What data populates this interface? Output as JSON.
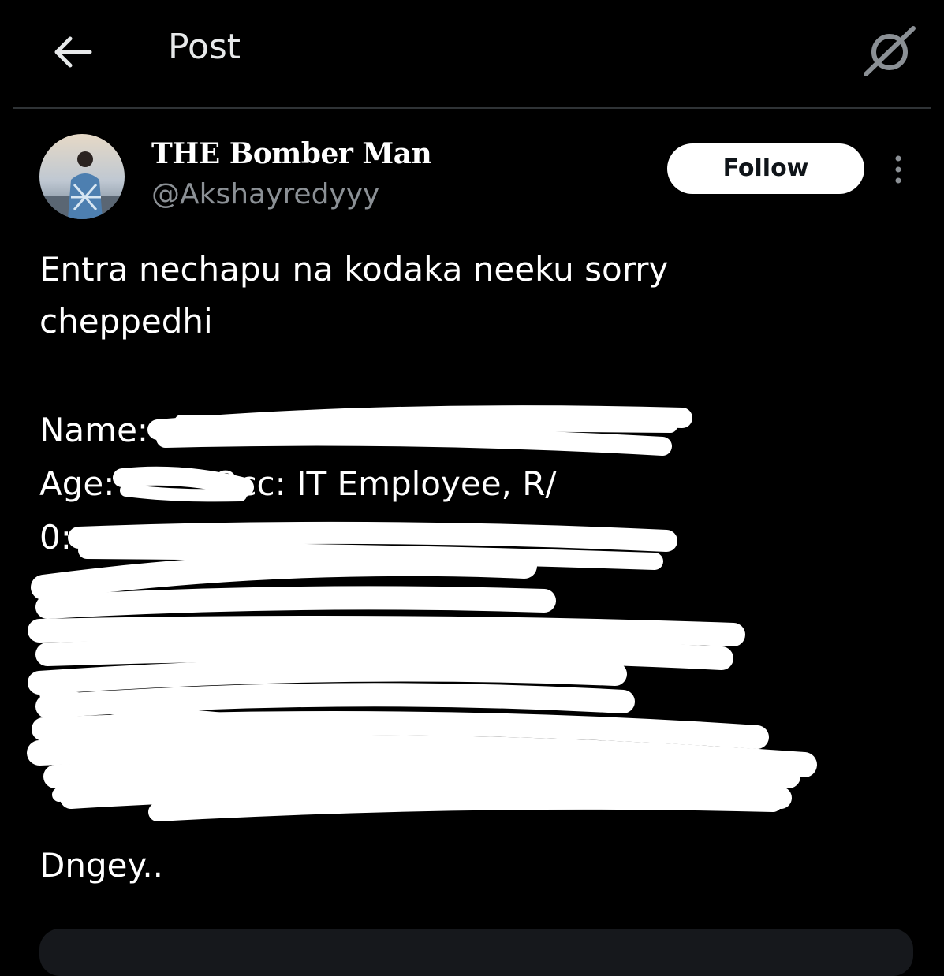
{
  "header": {
    "title": "Post",
    "back_icon": "arrow-left-icon",
    "grok_icon": "grok-icon"
  },
  "author": {
    "display_name": "THE Bomber Man",
    "handle": "@Akshayredyyy",
    "follow_label": "Follow",
    "more_icon": "more-vertical-icon"
  },
  "post": {
    "lines": [
      "Entra nechapu na kodaka neeku sorry",
      "cheppedhi",
      "Name:",
      "Age:",
      "Occ: IT Employee, R/",
      "0:",
      "Dngey.."
    ]
  },
  "colors": {
    "background": "#000000",
    "text": "#ffffff",
    "secondary_text": "#8b9095",
    "divider": "#2f3336",
    "follow_bg": "#ffffff",
    "follow_text": "#0f1419",
    "redaction": "#ffffff"
  }
}
